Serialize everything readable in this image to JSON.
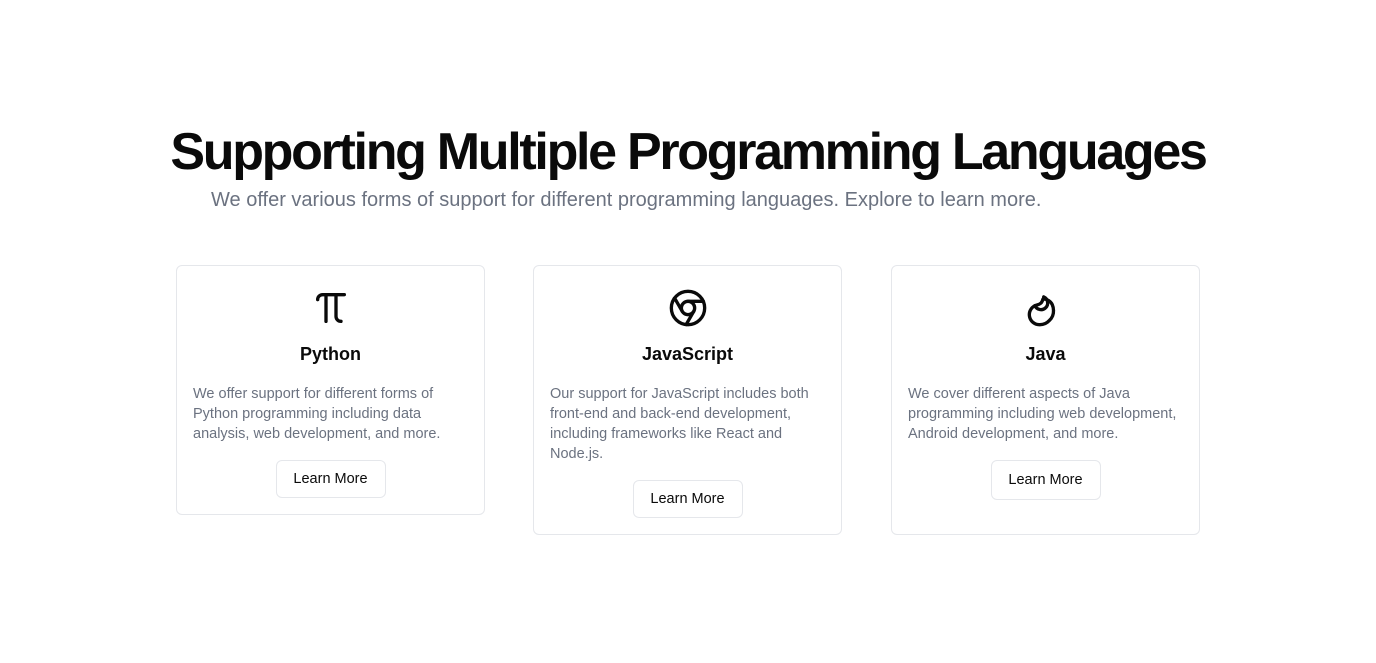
{
  "header": {
    "title": "Supporting Multiple Programming Languages",
    "subtitle": "We offer various forms of support for different programming languages. Explore to learn more."
  },
  "cards": [
    {
      "icon": "pi-icon",
      "title": "Python",
      "description": "We offer support for different forms of Python programming including data analysis, web development, and more.",
      "button_label": "Learn More"
    },
    {
      "icon": "chrome-icon",
      "title": "JavaScript",
      "description": "Our support for JavaScript includes both front-end and back-end development, including frameworks like React and Node.js.",
      "button_label": "Learn More"
    },
    {
      "icon": "bean-icon",
      "title": "Java",
      "description": "We cover different aspects of Java programming including web development, Android development, and more.",
      "button_label": "Learn More"
    }
  ],
  "colors": {
    "text": "#0a0a0a",
    "muted": "#6b7280",
    "border": "#e5e7eb"
  }
}
